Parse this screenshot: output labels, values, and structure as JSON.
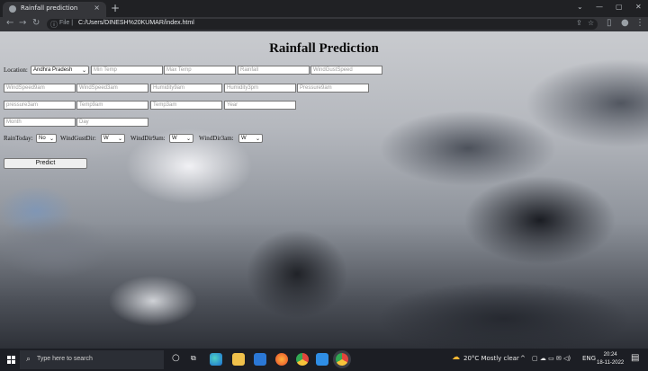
{
  "browser": {
    "tab_title": "Rainfall prediction",
    "tab_close": "×",
    "new_tab": "+",
    "window_min": "—",
    "window_max": "▢",
    "window_close": "✕",
    "nav_back": "←",
    "nav_forward": "→",
    "nav_reload": "↻",
    "address_scheme": "File |",
    "address_url": "C:/Users/DINESH%20KUMAR/index.html"
  },
  "page": {
    "title": "Rainfall Prediction",
    "location_label": "Location:",
    "location_value": "Andhra Pradesh",
    "row1_placeholders": [
      "Min Temp",
      "Max Temp",
      "Rainfall",
      "WindGustSpeed"
    ],
    "row2_placeholders": [
      "WindSpeed9am",
      "WindSpeed3am",
      "Humidity9am",
      "Humidity3pm",
      "Pressure9am"
    ],
    "row3_placeholders": [
      "pressure3am",
      "Temp9am",
      "Temp3am",
      "Year"
    ],
    "row4_placeholders": [
      "Month",
      "Day"
    ],
    "rain_today_label": "RainToday:",
    "rain_today_value": "No",
    "wind_gust_dir_label": "WindGustDir:",
    "wind_gust_dir_value": "W",
    "wind_dir_9am_label": "WindDir9am:",
    "wind_dir_9am_value": "W",
    "wind_dir_3am_label": "WindDir3am:",
    "wind_dir_3am_value": "W",
    "predict_label": "Predict"
  },
  "taskbar": {
    "search_placeholder": "Type here to search",
    "weather": "20°C  Mostly clear",
    "language": "ENG",
    "time": "20:24",
    "date": "18-11-2022"
  },
  "colors": {
    "chrome_dark": "#202124",
    "chrome_toolbar": "#35363a",
    "taskbar": "#1c1e24",
    "vscode_blue": "#2f8ee5",
    "chrome_red": "#e2453c",
    "chrome_yellow": "#f7c33a",
    "chrome_green": "#31a853"
  }
}
